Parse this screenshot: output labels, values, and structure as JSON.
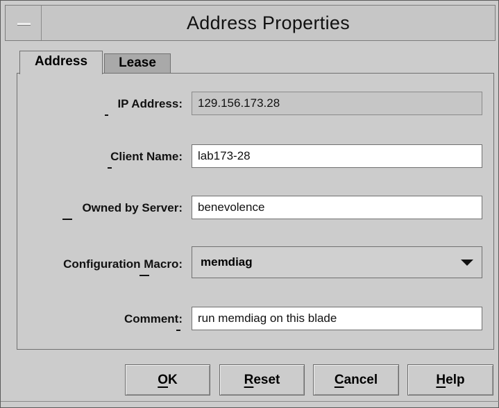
{
  "window": {
    "title": "Address Properties"
  },
  "tabs": [
    {
      "label": "Address",
      "selected": true
    },
    {
      "label": "Lease",
      "selected": false
    }
  ],
  "form": {
    "ip_address": {
      "label": "IP Address:",
      "value": "129.156.173.28",
      "editable": false
    },
    "client_name": {
      "label": "Client Name:",
      "value": "lab173-28"
    },
    "owned_by_server": {
      "label": "Owned by Server:",
      "value": "benevolence"
    },
    "configuration_macro": {
      "label": "Configuration Macro:",
      "value": "memdiag"
    },
    "comment": {
      "label": "Comment:",
      "value": "run memdiag on this blade"
    }
  },
  "buttons": {
    "ok": {
      "mnemonic": "O",
      "rest": "K"
    },
    "reset": {
      "mnemonic": "R",
      "rest": "eset"
    },
    "cancel": {
      "mnemonic": "C",
      "rest": "ancel"
    },
    "help": {
      "mnemonic": "H",
      "rest": "elp"
    }
  },
  "icons": {
    "window_menu": "window-menu-icon",
    "dropdown": "chevron-down-icon"
  }
}
